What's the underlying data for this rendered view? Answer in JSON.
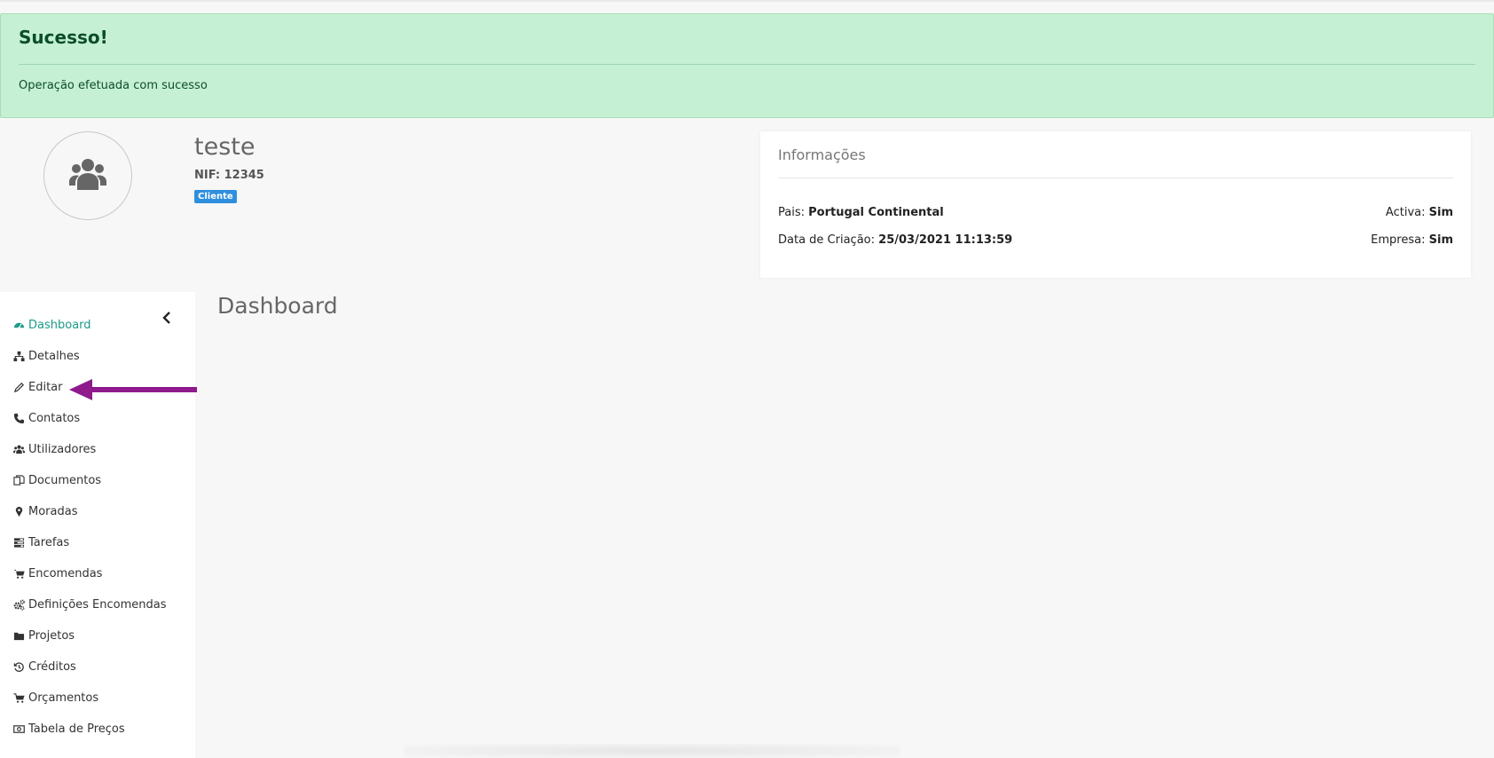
{
  "alert": {
    "title": "Sucesso!",
    "message": "Operação efetuada com sucesso",
    "bg_color": "#c5f0d4"
  },
  "profile": {
    "avatar_icon": "users-icon",
    "name": "teste",
    "nif": "NIF: 12345",
    "badge": "Cliente",
    "badge_color": "#2f8fde"
  },
  "info": {
    "title": "Informações",
    "rows": [
      {
        "left_label": "Pais:",
        "left_value": "Portugal Continental",
        "right_label": "Activa:",
        "right_value": "Sim"
      },
      {
        "left_label": "Data de Criação:",
        "left_value": "25/03/2021 11:13:59",
        "right_label": "Empresa:",
        "right_value": "Sim"
      }
    ]
  },
  "sidebar": {
    "collapse_icon": "chevron-left-icon",
    "items": [
      {
        "label": "Dashboard",
        "icon": "dashboard-icon",
        "active": true
      },
      {
        "label": "Detalhes",
        "icon": "sitemap-icon"
      },
      {
        "label": "Editar",
        "icon": "pencil-icon"
      },
      {
        "label": "Contatos",
        "icon": "phone-icon"
      },
      {
        "label": "Utilizadores",
        "icon": "users-icon"
      },
      {
        "label": "Documentos",
        "icon": "copy-icon"
      },
      {
        "label": "Moradas",
        "icon": "map-marker-icon"
      },
      {
        "label": "Tarefas",
        "icon": "tasks-icon"
      },
      {
        "label": "Encomendas",
        "icon": "cart-icon"
      },
      {
        "label": "Definições Encomendas",
        "icon": "cogs-icon"
      },
      {
        "label": "Projetos",
        "icon": "folder-icon"
      },
      {
        "label": "Créditos",
        "icon": "history-icon"
      },
      {
        "label": "Orçamentos",
        "icon": "cart-icon"
      },
      {
        "label": "Tabela de Preços",
        "icon": "money-icon"
      }
    ],
    "active_color": "#1a9a8a"
  },
  "main": {
    "title": "Dashboard"
  },
  "annotation": {
    "arrow_color": "#8e1a8c"
  }
}
